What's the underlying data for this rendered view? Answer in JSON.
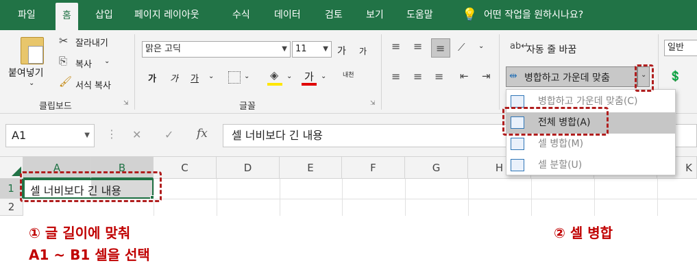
{
  "menu": {
    "tabs": [
      "파일",
      "홈",
      "삽입",
      "페이지 레이아웃",
      "수식",
      "데이터",
      "검토",
      "보기",
      "도움말"
    ],
    "active": "홈",
    "tell_me": "어떤 작업을 원하시나요?"
  },
  "clipboard": {
    "paste": "붙여넣기",
    "cut": "잘라내기",
    "copy": "복사",
    "format_painter": "서식 복사",
    "group": "클립보드"
  },
  "font": {
    "name": "맑은 고딕",
    "size": "11",
    "grow": "가",
    "shrink": "가",
    "bold": "가",
    "italic": "가",
    "underline": "가",
    "font_color_glyph": "가",
    "phonetic": "내천",
    "group": "글꼴"
  },
  "alignment": {
    "wrap_text": "자동 줄 바꿈",
    "merge_center": "병합하고 가운데 맞춤",
    "number_format": "일반"
  },
  "formula_bar": {
    "name_box": "A1",
    "cancel": "✕",
    "enter": "✓",
    "fx": "fx",
    "content": "셀 너비보다 긴 내용"
  },
  "grid": {
    "columns": [
      "A",
      "B",
      "C",
      "D",
      "E",
      "F",
      "G",
      "H",
      "",
      "K"
    ],
    "rows": [
      "1",
      "2"
    ],
    "a1": "셀 너비보다 긴 내용"
  },
  "merge_menu": {
    "items": [
      {
        "label": "병합하고 가운데 맞춤(C)"
      },
      {
        "label": "전체 병합(A)"
      },
      {
        "label": "셀 병합(M)"
      },
      {
        "label": "셀 분할(U)"
      }
    ]
  },
  "annotations": {
    "step1_line1": "① 글 길이에 맞춰",
    "step1_line2": "A1 ~ B1 셀을 선택",
    "step2": "② 셀 병합"
  },
  "colors": {
    "excel_green": "#217346",
    "annotation_red": "#c00000"
  }
}
